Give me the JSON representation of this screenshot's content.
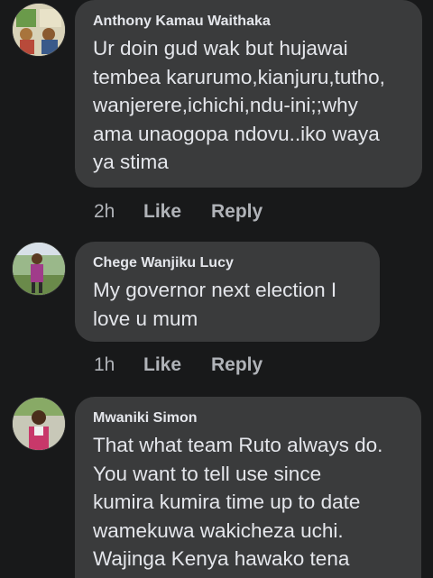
{
  "comments": [
    {
      "author": "Anthony Kamau Waithaka",
      "text": "Ur doin gud wak but hujawai\ntembea karurumo,kianjuru,tutho,\nwanjerere,ichichi,ndu-ini;;why\nama unaogopa ndovu..iko waya\nya stima",
      "time": "2h",
      "like_label": "Like",
      "reply_label": "Reply"
    },
    {
      "author": "Chege Wanjiku Lucy",
      "text": "My governor  next election I\nlove u mum",
      "time": "1h",
      "like_label": "Like",
      "reply_label": "Reply"
    },
    {
      "author": "Mwaniki Simon",
      "text": "That what team Ruto always do.\nYou want to tell use since\nkumira kumira time up to date\nwamekuwa wakicheza uchi.\nWajinga Kenya hawako tena",
      "time": "",
      "like_label": "",
      "reply_label": ""
    }
  ]
}
